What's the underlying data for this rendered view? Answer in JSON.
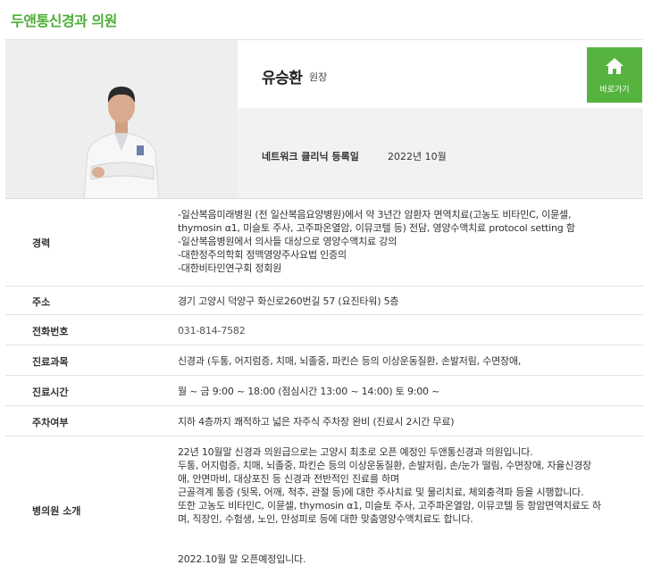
{
  "clinic_name": "두앤통신경과 의원",
  "doctor": {
    "name": "유승환",
    "title": "원장",
    "registered_label": "네트워크 클리닉 등록일",
    "registered_date": "2022년 10월"
  },
  "go_button": {
    "label": "바로가기",
    "icon": "home-icon"
  },
  "colors": {
    "accent": "#56b43e",
    "title_green": "#4caf35"
  },
  "details": {
    "career": {
      "label": "경력",
      "lines": [
        "-일산복음미래병원 (전 일산복음요양병원)에서 약 3년간 암환자 면역치료(고농도 비타민C, 이뮨셀,",
        "thymosin α1, 미슬토 주사, 고주파온열암, 이뮤코텔 등) 전담, 영양수액치료 protocol setting 함",
        "-일산복음병원에서 의사들 대상으로 영양수액치료 강의",
        "-대한정주의학회 정맥영양주사요법 인증의",
        "-대한비타민연구회 정회원"
      ]
    },
    "address": {
      "label": "주소",
      "value": "경기 고양시 덕양구 화신로260번길 57 (요진타워) 5층"
    },
    "phone": {
      "label": "전화번호",
      "value": "031-814-7582"
    },
    "departments": {
      "label": "진료과목",
      "value": "신경과 (두통, 어지럼증, 치매, 뇌졸중, 파킨슨 등의 이상운동질환, 손발저림, 수면장애,"
    },
    "hours": {
      "label": "진료시간",
      "value": "월 ~ 금 9:00 ~ 18:00 (점심시간 13:00 ~ 14:00) 토 9:00 ~"
    },
    "parking": {
      "label": "주차여부",
      "value": "지하 4층까지 쾌적하고 넓은 자주식 주차장 완비 (진료시 2시간 무료)"
    },
    "intro": {
      "label": "병의원 소개",
      "lines": [
        "22년 10월말 신경과 의원급으로는 고양시 최초로 오픈 예정인 두앤통신경과 의원입니다.",
        "두통, 어지럼증, 치매, 뇌졸중, 파킨슨 등의 이상운동질환, 손발저림, 손/눈가 떨림, 수면장애, 자율신경장",
        "애, 안면마비, 대상포진 등 신경과 전반적인 진료를 하며",
        "근골격계 통증 (뒷목, 어깨, 척추, 관절 등)에 대한 주사치료 및 물리치료, 체외충격파 등을 시행합니다.",
        "또한 고농도 비타민C, 이뮨셀, thymosin α1, 미슬토 주사, 고주파온열암, 이뮤코텔 등 항암면역치료도 하",
        "며, 직장인, 수험생, 노인, 만성피로 등에 대한 맞춤영양수액치료도 합니다."
      ],
      "closing": "2022.10월 말 오픈예정입니다."
    }
  }
}
